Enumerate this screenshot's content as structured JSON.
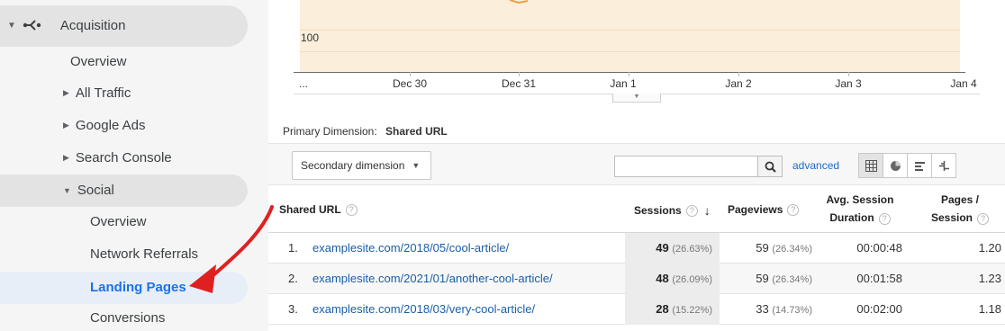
{
  "sidebar": {
    "items": [
      {
        "label": "Acquisition"
      },
      {
        "label": "Overview"
      },
      {
        "label": "All Traffic"
      },
      {
        "label": "Google Ads"
      },
      {
        "label": "Search Console"
      },
      {
        "label": "Social"
      },
      {
        "label": "Overview"
      },
      {
        "label": "Network Referrals"
      },
      {
        "label": "Landing Pages"
      },
      {
        "label": "Conversions"
      }
    ]
  },
  "chart": {
    "y_tick": "100",
    "x_ticks": [
      "...",
      "Dec 30",
      "Dec 31",
      "Jan 1",
      "Jan 2",
      "Jan 3",
      "Jan 4"
    ]
  },
  "chart_data": {
    "type": "area",
    "x": [
      "...",
      "Dec 30",
      "Dec 31",
      "Jan 1",
      "Jan 2",
      "Jan 3",
      "Jan 4"
    ],
    "ytick_visible": 100,
    "colors": {
      "fill": "#fbeedb",
      "grid": "#f3dcbb"
    }
  },
  "primary_dimension": {
    "label": "Primary Dimension:",
    "value": "Shared URL"
  },
  "toolbar": {
    "secondary_label": "Secondary dimension",
    "search_value": "",
    "advanced_label": "advanced"
  },
  "table": {
    "headers": {
      "shared_url": "Shared URL",
      "sessions": "Sessions",
      "pageviews": "Pageviews",
      "avg_line1": "Avg. Session",
      "avg_line2": "Duration",
      "pps_line1": "Pages /",
      "pps_line2": "Session",
      "help": "?",
      "sort_arrow": "↓"
    },
    "rows": [
      {
        "idx": "1.",
        "url": "examplesite.com/2018/05/cool-article/",
        "sessions": "49",
        "sessions_pct": "(26.63%)",
        "pageviews": "59",
        "pageviews_pct": "(26.34%)",
        "duration": "00:00:48",
        "pages": "1.20"
      },
      {
        "idx": "2.",
        "url": "examplesite.com/2021/01/another-cool-article/",
        "sessions": "48",
        "sessions_pct": "(26.09%)",
        "pageviews": "59",
        "pageviews_pct": "(26.34%)",
        "duration": "00:01:58",
        "pages": "1.23"
      },
      {
        "idx": "3.",
        "url": "examplesite.com/2018/03/very-cool-article/",
        "sessions": "28",
        "sessions_pct": "(15.22%)",
        "pageviews": "33",
        "pageviews_pct": "(14.73%)",
        "duration": "00:02:00",
        "pages": "1.18"
      }
    ]
  },
  "colors": {
    "link": "#1a5ea8",
    "active_nav": "#1a73e8",
    "annotation_arrow": "#e02020"
  }
}
